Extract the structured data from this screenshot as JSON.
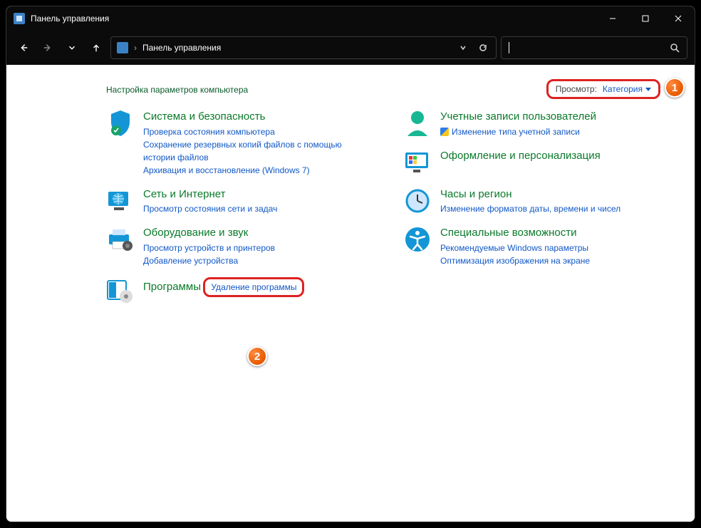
{
  "window_title": "Панель управления",
  "breadcrumb": {
    "root": "Панель управления"
  },
  "heading": "Настройка параметров компьютера",
  "view_by": {
    "label": "Просмотр:",
    "value": "Категория"
  },
  "markers": {
    "one": "1",
    "two": "2"
  },
  "left": [
    {
      "id": "system-security",
      "title": "Система и безопасность",
      "links": [
        "Проверка состояния компьютера",
        "Сохранение резервных копий файлов с помощью истории файлов",
        "Архивация и восстановление (Windows 7)"
      ]
    },
    {
      "id": "network",
      "title": "Сеть и Интернет",
      "links": [
        "Просмотр состояния сети и задач"
      ]
    },
    {
      "id": "hardware",
      "title": "Оборудование и звук",
      "links": [
        "Просмотр устройств и принтеров",
        "Добавление устройства"
      ]
    },
    {
      "id": "programs",
      "title": "Программы",
      "links": [
        "Удаление программы"
      ]
    }
  ],
  "right": [
    {
      "id": "accounts",
      "title": "Учетные записи пользователей",
      "links": [
        "Изменение типа учетной записи"
      ],
      "shield": true
    },
    {
      "id": "appearance",
      "title": "Оформление и персонализация",
      "links": []
    },
    {
      "id": "clock",
      "title": "Часы и регион",
      "links": [
        "Изменение форматов даты, времени и чисел"
      ]
    },
    {
      "id": "accessibility",
      "title": "Специальные возможности",
      "links": [
        "Рекомендуемые Windows параметры",
        "Оптимизация изображения на экране"
      ]
    }
  ]
}
